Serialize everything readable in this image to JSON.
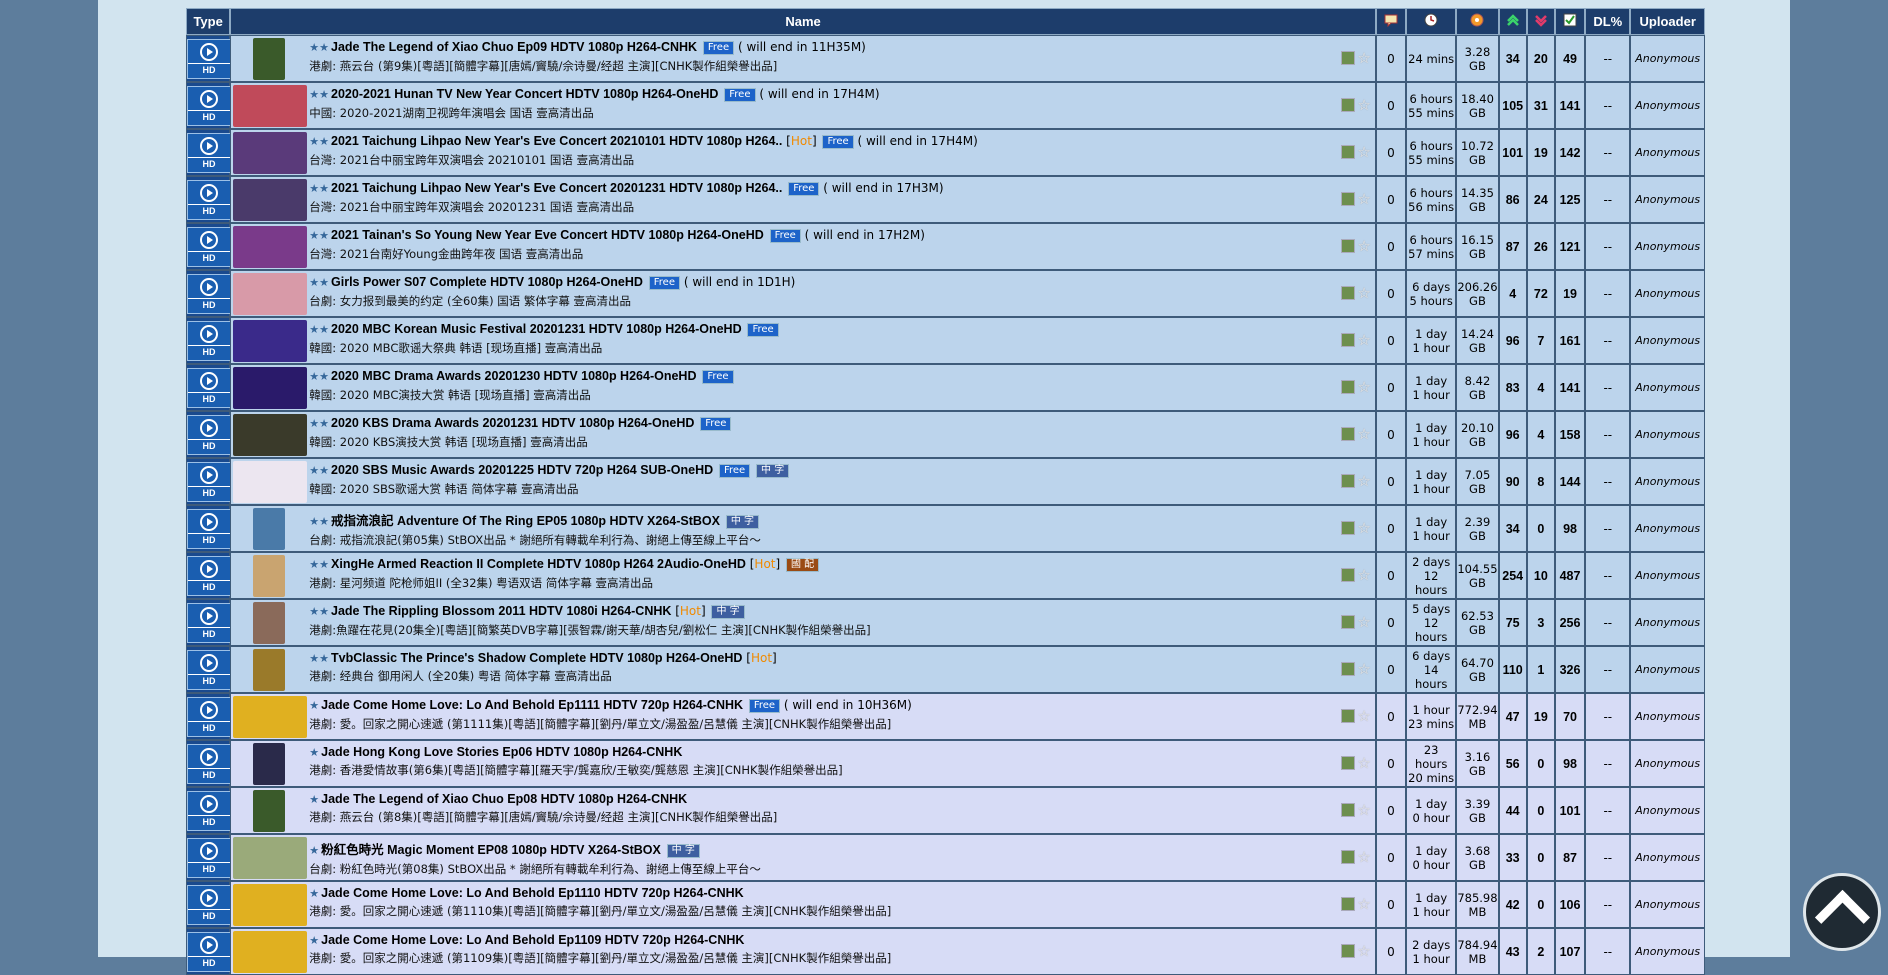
{
  "headers": {
    "type": "Type",
    "name": "Name",
    "dlpct": "DL%",
    "uploader": "Uploader"
  },
  "header_icons": [
    "comments-icon",
    "time-icon",
    "size-icon",
    "seeders-icon",
    "leechers-icon",
    "completed-icon"
  ],
  "type_label": "HD",
  "rows": [
    {
      "cls": "sticky",
      "thumb": "#3a5a2a",
      "narrow": true,
      "stars": 2,
      "title": "Jade The Legend of Xiao Chuo Ep09 HDTV 1080p H264-CNHK",
      "hot": false,
      "tags": [
        "Free"
      ],
      "note": "( will end in 11H35M)",
      "sub": "港劇: 燕云台 (第9集)[粵語][簡體字幕][唐嫣/竇驍/佘诗曼/经超 主演][CNHK製作組榮譽出品]",
      "comments": "0",
      "time": "24 mins",
      "time2": "",
      "size": "3.28",
      "unit": "GB",
      "seed": "34",
      "leech": "20",
      "done": "49",
      "dl": "--",
      "up": "Anonymous"
    },
    {
      "cls": "sticky",
      "thumb": "#c04a5a",
      "narrow": false,
      "stars": 2,
      "title": "2020-2021 Hunan TV New Year Concert HDTV 1080p H264-OneHD",
      "hot": false,
      "tags": [
        "Free"
      ],
      "note": "( will end in 17H4M)",
      "sub": "中國: 2020-2021湖南卫视跨年演唱会 国语 壹高清出品",
      "comments": "0",
      "time": "6 hours",
      "time2": "55 mins",
      "size": "18.40",
      "unit": "GB",
      "seed": "105",
      "leech": "31",
      "done": "141",
      "dl": "--",
      "up": "Anonymous"
    },
    {
      "cls": "sticky",
      "thumb": "#5a3a7a",
      "narrow": false,
      "stars": 2,
      "title": "2021 Taichung Lihpao New Year's Eve Concert 20210101 HDTV 1080p H264..",
      "hot": true,
      "tags": [
        "Free"
      ],
      "note": "( will end in 17H4M)",
      "sub": "台灣: 2021台中丽宝跨年双演唱会 20210101 国语 壹高清出品",
      "comments": "0",
      "time": "6 hours",
      "time2": "55 mins",
      "size": "10.72",
      "unit": "GB",
      "seed": "101",
      "leech": "19",
      "done": "142",
      "dl": "--",
      "up": "Anonymous"
    },
    {
      "cls": "sticky",
      "thumb": "#4a3a6a",
      "narrow": false,
      "stars": 2,
      "title": "2021 Taichung Lihpao New Year's Eve Concert 20201231 HDTV 1080p H264..",
      "hot": false,
      "tags": [
        "Free"
      ],
      "note": "( will end in 17H3M)",
      "sub": "台灣: 2021台中丽宝跨年双演唱会 20201231 国语 壹高清出品",
      "comments": "0",
      "time": "6 hours",
      "time2": "56 mins",
      "size": "14.35",
      "unit": "GB",
      "seed": "86",
      "leech": "24",
      "done": "125",
      "dl": "--",
      "up": "Anonymous"
    },
    {
      "cls": "sticky",
      "thumb": "#7a3a8a",
      "narrow": false,
      "stars": 2,
      "title": "2021 Tainan's So Young New Year Eve Concert HDTV 1080p H264-OneHD",
      "hot": false,
      "tags": [
        "Free"
      ],
      "note": "( will end in 17H2M)",
      "sub": "台灣: 2021台南好Young金曲跨年夜 国语 壹高清出品",
      "comments": "0",
      "time": "6 hours",
      "time2": "57 mins",
      "size": "16.15",
      "unit": "GB",
      "seed": "87",
      "leech": "26",
      "done": "121",
      "dl": "--",
      "up": "Anonymous"
    },
    {
      "cls": "sticky",
      "thumb": "#d89aa8",
      "narrow": false,
      "stars": 2,
      "title": "Girls Power S07 Complete HDTV 1080p H264-OneHD",
      "hot": false,
      "tags": [
        "Free"
      ],
      "note": "( will end in 1D1H)",
      "sub": "台劇: 女力报到最美的约定 (全60集) 国语 繁体字幕 壹高清出品",
      "comments": "0",
      "time": "6 days",
      "time2": "5 hours",
      "size": "206.26",
      "unit": "GB",
      "seed": "4",
      "seedRed": true,
      "leech": "72",
      "done": "19",
      "dl": "--",
      "up": "Anonymous"
    },
    {
      "cls": "sticky",
      "thumb": "#3a2a8a",
      "narrow": false,
      "stars": 2,
      "title": "2020 MBC Korean Music Festival 20201231 HDTV 1080p H264-OneHD",
      "hot": false,
      "tags": [
        "Free"
      ],
      "note": "",
      "sub": "韓國: 2020 MBC歌谣大祭典 韩语 [现场直播] 壹高清出品",
      "comments": "0",
      "time": "1 day",
      "time2": "1 hour",
      "size": "14.24",
      "unit": "GB",
      "seed": "96",
      "leech": "7",
      "done": "161",
      "dl": "--",
      "up": "Anonymous"
    },
    {
      "cls": "sticky",
      "thumb": "#2a1a6a",
      "narrow": false,
      "stars": 2,
      "title": "2020 MBC Drama Awards 20201230 HDTV 1080p H264-OneHD",
      "hot": false,
      "tags": [
        "Free"
      ],
      "note": "",
      "sub": "韓國: 2020 MBC演技大赏 韩语 [现场直播] 壹高清出品",
      "comments": "0",
      "time": "1 day",
      "time2": "1 hour",
      "size": "8.42",
      "unit": "GB",
      "seed": "83",
      "leech": "4",
      "done": "141",
      "dl": "--",
      "up": "Anonymous"
    },
    {
      "cls": "sticky",
      "thumb": "#3a3a2a",
      "narrow": false,
      "stars": 2,
      "title": "2020 KBS Drama Awards 20201231 HDTV 1080p H264-OneHD",
      "hot": false,
      "tags": [
        "Free"
      ],
      "note": "",
      "sub": "韓國: 2020 KBS演技大赏 韩语 [现场直播] 壹高清出品",
      "comments": "0",
      "time": "1 day",
      "time2": "1 hour",
      "size": "20.10",
      "unit": "GB",
      "seed": "96",
      "leech": "4",
      "done": "158",
      "dl": "--",
      "up": "Anonymous"
    },
    {
      "cls": "sticky",
      "thumb": "#ece6f0",
      "narrow": false,
      "stars": 2,
      "title": "2020 SBS Music Awards 20201225 HDTV 720p H264 SUB-OneHD",
      "hot": false,
      "tags": [
        "Free",
        "中 字"
      ],
      "note": "",
      "sub": "韓國: 2020 SBS歌谣大赏 韩语 简体字幕 壹高清出品",
      "comments": "0",
      "time": "1 day",
      "time2": "1 hour",
      "size": "7.05",
      "unit": "GB",
      "seed": "90",
      "leech": "8",
      "done": "144",
      "dl": "--",
      "up": "Anonymous"
    },
    {
      "cls": "sticky",
      "thumb": "#4a7aa8",
      "narrow": true,
      "stars": 2,
      "title": "戒指流浪記 Adventure Of The Ring EP05 1080p HDTV X264-StBOX",
      "hot": false,
      "tags": [
        "中 字"
      ],
      "note": "",
      "sub": "台劇: 戒指流浪記(第05集)   StBOX出品   * 謝絕所有轉載牟利行為、謝絕上傳至線上平台～",
      "comments": "0",
      "time": "1 day",
      "time2": "1 hour",
      "size": "2.39",
      "unit": "GB",
      "seed": "34",
      "leech": "0",
      "done": "98",
      "dl": "--",
      "up": "Anonymous"
    },
    {
      "cls": "sticky",
      "thumb": "#c9a470",
      "narrow": true,
      "stars": 2,
      "title": "XingHe Armed Reaction II Complete HDTV 1080p H264 2Audio-OneHD",
      "hot": true,
      "tags": [
        "國 配"
      ],
      "note": "",
      "sub": "港劇: 星河频道 陀枪师姐II (全32集) 粤语双语 简体字幕 壹高清出品",
      "comments": "0",
      "time": "2 days",
      "time2": "12 hours",
      "size": "104.55",
      "unit": "GB",
      "seed": "254",
      "leech": "10",
      "done": "487",
      "dl": "--",
      "up": "Anonymous"
    },
    {
      "cls": "sticky",
      "thumb": "#8a6a5a",
      "narrow": true,
      "stars": 2,
      "title": "Jade The Rippling Blossom 2011 HDTV 1080i H264-CNHK",
      "hot": true,
      "tags": [
        "中 字"
      ],
      "note": "",
      "sub": "港劇:魚躍在花見(20集全)[粵語][簡繁英DVB字幕][張智霖/謝天華/胡杏兒/劉松仁 主演][CNHK製作組榮譽出品]",
      "comments": "0",
      "time": "5 days",
      "time2": "12 hours",
      "size": "62.53",
      "unit": "GB",
      "seed": "75",
      "leech": "3",
      "done": "256",
      "dl": "--",
      "up": "Anonymous"
    },
    {
      "cls": "sticky",
      "thumb": "#9a7a2a",
      "narrow": true,
      "stars": 2,
      "title": "TvbClassic The Prince's Shadow Complete HDTV 1080p H264-OneHD",
      "hot": true,
      "tags": [],
      "note": "",
      "sub": "港劇: 经典台 御用闲人 (全20集) 粤语 简体字幕 壹高清出品",
      "comments": "0",
      "time": "6 days",
      "time2": "14 hours",
      "size": "64.70",
      "unit": "GB",
      "seed": "110",
      "leech": "1",
      "done": "326",
      "dl": "--",
      "up": "Anonymous"
    },
    {
      "cls": "normal",
      "thumb": "#e0b020",
      "narrow": false,
      "stars": 1,
      "title": "Jade Come Home Love:  Lo And Behold Ep1111 HDTV 720p H264-CNHK",
      "hot": false,
      "tags": [
        "Free"
      ],
      "note": "( will end in 10H36M)",
      "sub": "港劇: 愛。回家之開心速遞 (第1111集)[粵語][簡體字幕][劉丹/單立文/湯盈盈/呂慧儀 主演][CNHK製作組榮譽出品]",
      "comments": "0",
      "time": "1 hour",
      "time2": "23 mins",
      "size": "772.94",
      "unit": "MB",
      "seed": "47",
      "leech": "19",
      "done": "70",
      "dl": "--",
      "up": "Anonymous"
    },
    {
      "cls": "normal",
      "thumb": "#2a2a4a",
      "narrow": true,
      "stars": 1,
      "title": "Jade Hong Kong Love Stories Ep06 HDTV 1080p H264-CNHK",
      "hot": false,
      "tags": [],
      "note": "",
      "sub": "港劇: 香港愛情故事(第6集)[粵語][簡體字幕][羅天宇/龔嘉欣/王敏奕/龔慈恩 主演][CNHK製作組榮譽出品]",
      "comments": "0",
      "time": "23 hours",
      "time2": "20 mins",
      "size": "3.16",
      "unit": "GB",
      "seed": "56",
      "leech": "0",
      "done": "98",
      "dl": "--",
      "up": "Anonymous"
    },
    {
      "cls": "normal",
      "thumb": "#3a5a2a",
      "narrow": true,
      "stars": 1,
      "title": "Jade The Legend of Xiao Chuo Ep08 HDTV 1080p H264-CNHK",
      "hot": false,
      "tags": [],
      "note": "",
      "sub": "港劇: 燕云台 (第8集)[粵語][簡體字幕][唐嫣/竇驍/佘诗曼/经超 主演][CNHK製作組榮譽出品]",
      "comments": "0",
      "time": "1 day",
      "time2": "0 hour",
      "size": "3.39",
      "unit": "GB",
      "seed": "44",
      "leech": "0",
      "done": "101",
      "dl": "--",
      "up": "Anonymous"
    },
    {
      "cls": "normal",
      "thumb": "#9aaa7a",
      "narrow": false,
      "stars": 1,
      "title": "粉紅色時光 Magic Moment EP08 1080p HDTV X264-StBOX",
      "hot": false,
      "tags": [
        "中 字"
      ],
      "note": "",
      "sub": "台劇: 粉紅色時光(第08集)   StBOX出品   * 謝絕所有轉載牟利行為、謝絕上傳至線上平台～",
      "comments": "0",
      "time": "1 day",
      "time2": "0 hour",
      "size": "3.68",
      "unit": "GB",
      "seed": "33",
      "leech": "0",
      "done": "87",
      "dl": "--",
      "up": "Anonymous"
    },
    {
      "cls": "normal",
      "thumb": "#e0b020",
      "narrow": false,
      "stars": 1,
      "title": "Jade Come Home Love:  Lo And Behold Ep1110 HDTV 720p H264-CNHK",
      "hot": false,
      "tags": [],
      "note": "",
      "sub": "港劇: 愛。回家之開心速遞 (第1110集)[粵語][簡體字幕][劉丹/單立文/湯盈盈/呂慧儀 主演][CNHK製作組榮譽出品]",
      "comments": "0",
      "time": "1 day",
      "time2": "1 hour",
      "size": "785.98",
      "unit": "MB",
      "seed": "42",
      "leech": "0",
      "done": "106",
      "dl": "--",
      "up": "Anonymous"
    },
    {
      "cls": "normal",
      "thumb": "#e0b020",
      "narrow": false,
      "stars": 1,
      "title": "Jade Come Home Love:  Lo And Behold Ep1109 HDTV 720p H264-CNHK",
      "hot": false,
      "tags": [],
      "note": "",
      "sub": "港劇: 愛。回家之開心速遞 (第1109集)[粵語][簡體字幕][劉丹/單立文/湯盈盈/呂慧儀 主演][CNHK製作組榮譽出品]",
      "comments": "0",
      "time": "2 days",
      "time2": "1 hour",
      "size": "784.94",
      "unit": "MB",
      "seed": "43",
      "leech": "2",
      "done": "107",
      "dl": "--",
      "up": "Anonymous"
    }
  ],
  "colors": {
    "header": "#1d3d6b",
    "sticky_row": "#bcd4ec",
    "normal_row": "#d7dcf6",
    "hot": "#f08a00",
    "free_tag": "#1d63c9"
  }
}
